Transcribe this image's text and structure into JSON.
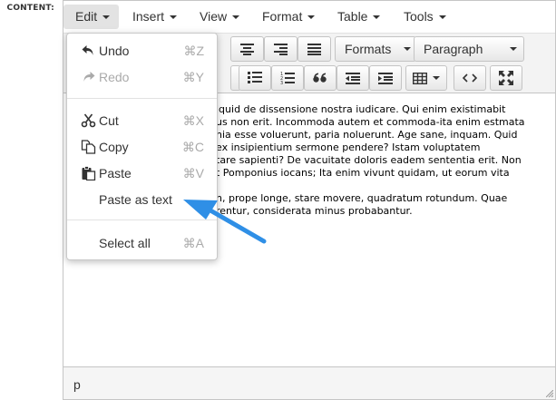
{
  "label": "CONTENT:",
  "menubar": {
    "items": [
      {
        "label": "Edit",
        "active": true
      },
      {
        "label": "Insert"
      },
      {
        "label": "View"
      },
      {
        "label": "Format"
      },
      {
        "label": "Table"
      },
      {
        "label": "Tools"
      }
    ]
  },
  "toolbar": {
    "formats_label": "Formats",
    "block_format": "Paragraph",
    "row1_icons": [
      "align-center-icon",
      "align-right-icon",
      "align-justify-icon"
    ],
    "row2_icons": [
      "unordered-list-icon",
      "ordered-list-icon",
      "blockquote-icon",
      "outdent-icon",
      "indent-icon",
      "table-icon",
      "code-icon",
      "fullscreen-icon"
    ]
  },
  "edit_menu": {
    "items": [
      {
        "label": "Undo",
        "shortcut": "⌘Z",
        "icon": "undo-icon",
        "disabled": false
      },
      {
        "label": "Redo",
        "shortcut": "⌘Y",
        "icon": "redo-icon",
        "disabled": true
      },
      {
        "label": "Cut",
        "shortcut": "⌘X",
        "icon": "cut-icon",
        "disabled": false
      },
      {
        "label": "Copy",
        "shortcut": "⌘C",
        "icon": "copy-icon",
        "disabled": false
      },
      {
        "label": "Paste",
        "shortcut": "⌘V",
        "icon": "paste-icon",
        "disabled": false
      },
      {
        "label": "Paste as text",
        "shortcut": "",
        "icon": "",
        "disabled": false
      },
      {
        "label": "Select all",
        "shortcut": "⌘A",
        "icon": "",
        "disabled": false
      }
    ]
  },
  "content": {
    "lines": [
      "iquid de dissensione nostra iudicare. Qui enim existimabit",
      "us non erit. Incommoda autem et commoda-ita enim estmata",
      "nia esse voluerunt, paria noluerunt. Age sane, inquam. Quid",
      "ex insipientium sermone pendere? Istam voluptatem",
      "tare sapienti? De vacuitate doloris eadem sententia erit. Non",
      "t Pomponius iocans; Ita enim vivunt quidam, ut eorum vita",
      "",
      "n, prope longe, stare movere, quadratum rotundum. Quae",
      "rentur, considerata minus probabantur."
    ]
  },
  "statusbar": {
    "path": "p"
  },
  "colors": {
    "arrow": "#2f8fe6",
    "menu_active": "#e3e3e3",
    "toolbar_bg": "#f3f3f3"
  }
}
